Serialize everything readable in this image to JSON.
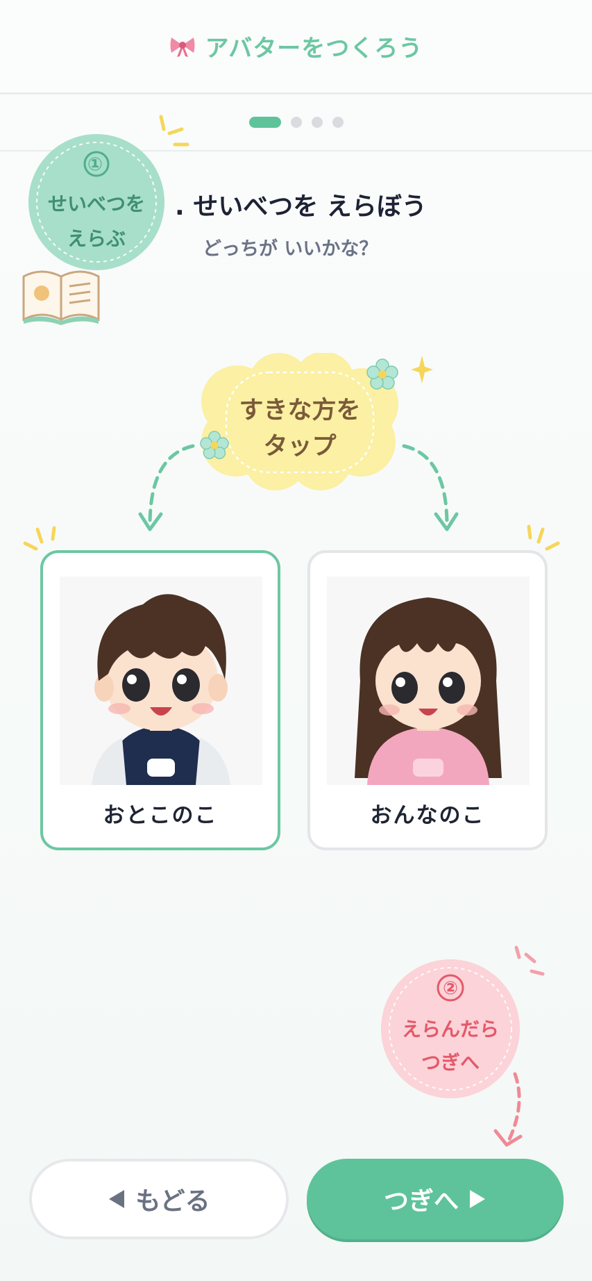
{
  "header": {
    "title": "アバターをつくろう",
    "icon": "ribbon-icon"
  },
  "progress": {
    "current_step": 1,
    "total_steps": 4
  },
  "hint1": {
    "number": "①",
    "line1": "せいべつを",
    "line2": "えらぶ"
  },
  "step": {
    "heading": ". せいべつを えらぼう",
    "subheading": "どっちが いいかな？"
  },
  "tap_hint": {
    "line1": "すきな方を",
    "line2": "タップ"
  },
  "options": [
    {
      "label": "おとこのこ",
      "selected": true
    },
    {
      "label": "おんなのこ",
      "selected": false
    }
  ],
  "hint2": {
    "number": "②",
    "line1": "えらんだら",
    "line2": "つぎへ"
  },
  "buttons": {
    "back_label": "もどる",
    "next_label": "つぎへ"
  },
  "colors": {
    "accent": "#5ec39b",
    "pink": "#e3596a",
    "yellow": "#fbf0a3"
  }
}
